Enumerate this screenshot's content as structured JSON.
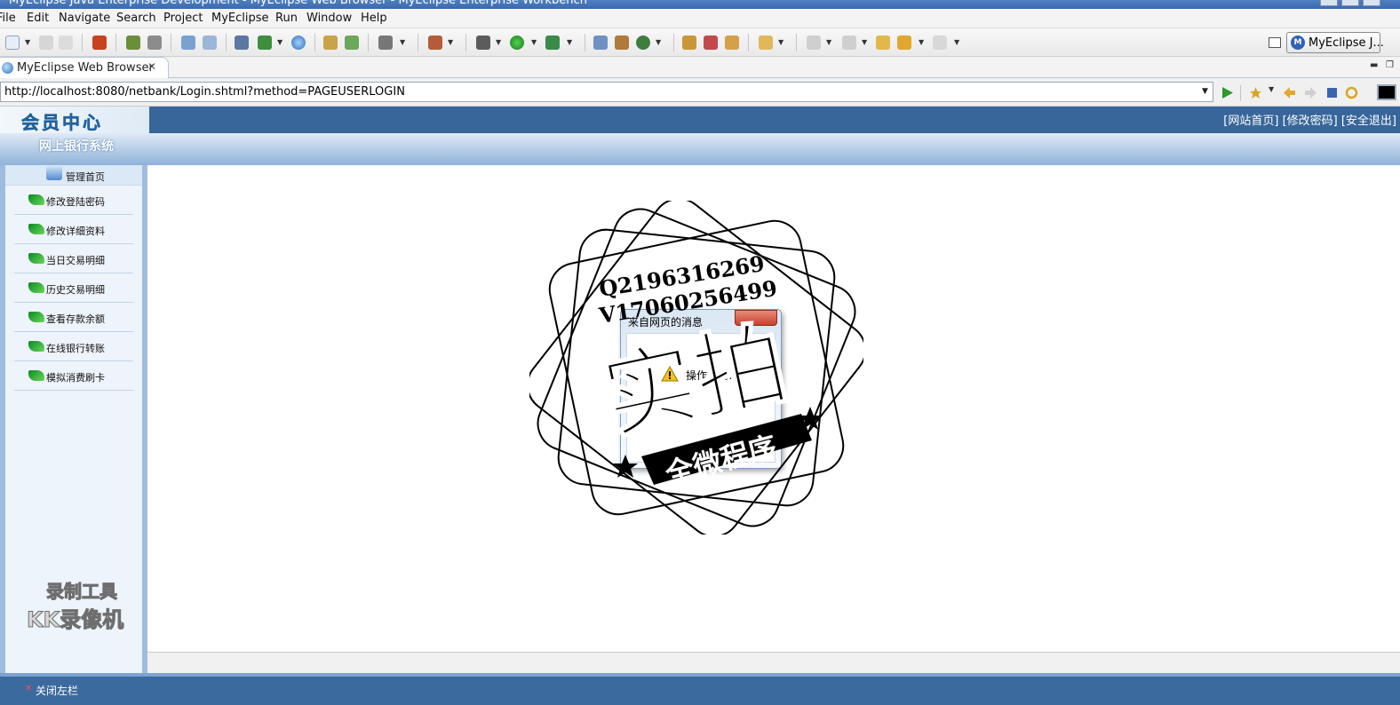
{
  "window": {
    "title": "MyEclipse Java Enterprise Development - MyEclipse Web Browser - MyEclipse Enterprise Workbench"
  },
  "menu": [
    "File",
    "Edit",
    "Navigate",
    "Search",
    "Project",
    "MyEclipse",
    "Run",
    "Window",
    "Help"
  ],
  "perspective": {
    "label": "MyEclipse J...",
    "icon": "myeclipse-icon"
  },
  "editor_tab": {
    "label": "MyEclipse Web Browser",
    "icon": "globe-icon"
  },
  "browser": {
    "url": "http://localhost:8080/netbank/Login.shtml?method=PAGEUSERLOGIN"
  },
  "page": {
    "logo": "会员中心",
    "header_links": "[网站首页] [修改密码] [安全退出]",
    "system_name": "网上银行系统",
    "home_label": "管理首页",
    "menu_items": [
      "修改登陆密码",
      "修改详细资料",
      "当日交易明细",
      "历史交易明细",
      "查看存款余额",
      "在线银行转账",
      "模拟消费刷卡"
    ],
    "footer_label": "关闭左栏"
  },
  "dialog": {
    "title": "来自网页的消息",
    "message": "操作成功!"
  },
  "watermark": {
    "qq": "Q2196316269",
    "vx": "V17060256499",
    "big": "实拍",
    "banner": "全微程序",
    "recorder_line1": "录制工具",
    "recorder_line2": "KK录像机"
  },
  "colors": {
    "header_blue": "#38669a",
    "band_blue": "#8fb2da",
    "sidebar_bg": "#eef4fb",
    "menu_icon_green": "#1a9a2e"
  }
}
